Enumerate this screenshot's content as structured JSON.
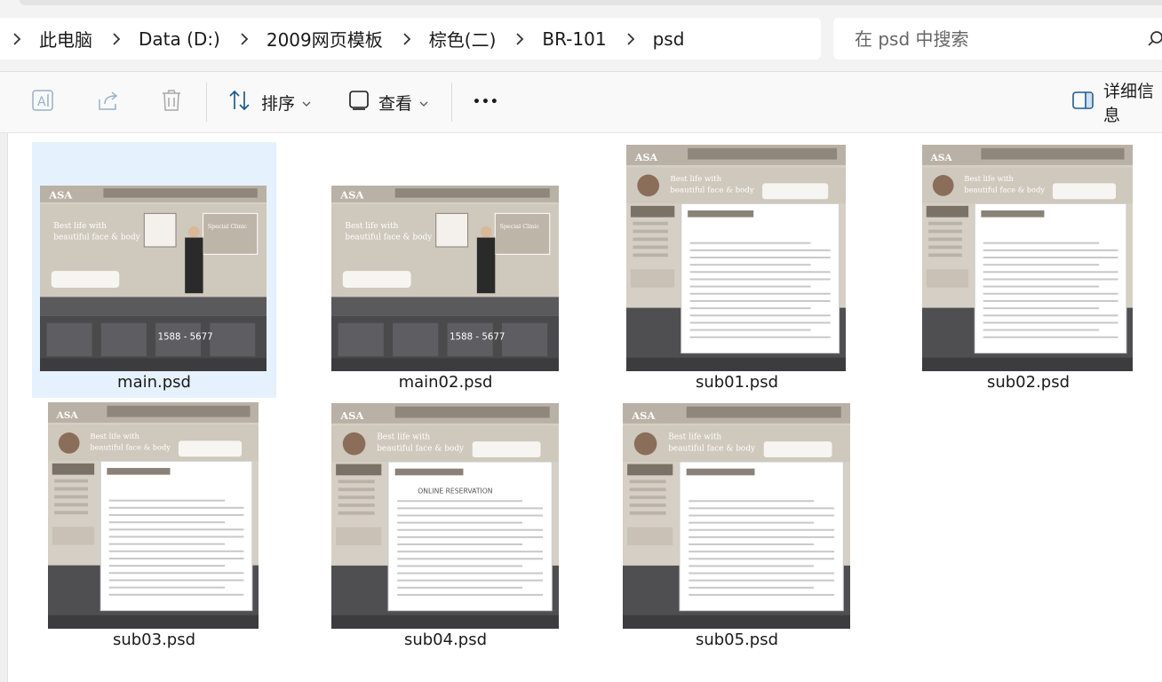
{
  "address": {
    "breadcrumbs": [
      "此电脑",
      "Data (D:)",
      "2009网页模板",
      "棕色(二)",
      "BR-101",
      "psd"
    ],
    "search_placeholder": "在 psd 中搜索"
  },
  "toolbar": {
    "sort_label": "排序",
    "view_label": "查看",
    "more_label": "•••",
    "details_label": "详细信息"
  },
  "files": [
    {
      "name": "main.psd",
      "selected": true,
      "style": "main"
    },
    {
      "name": "main02.psd",
      "selected": false,
      "style": "main"
    },
    {
      "name": "sub01.psd",
      "selected": false,
      "style": "sub"
    },
    {
      "name": "sub02.psd",
      "selected": false,
      "style": "sub"
    },
    {
      "name": "sub03.psd",
      "selected": false,
      "style": "sub"
    },
    {
      "name": "sub04.psd",
      "selected": false,
      "style": "sub"
    },
    {
      "name": "sub05.psd",
      "selected": false,
      "style": "sub"
    }
  ],
  "thumbnail_text": {
    "logo": "ASA",
    "tagline1": "Best life with",
    "tagline2": "beautiful face & body",
    "phone": "1588 - 5677",
    "clinic": "Special Clinic",
    "online": "ONLINE RESERVATION"
  },
  "colors": {
    "selection": "#e5f2fd",
    "window_bg": "#f3f3f3",
    "thumb_header": "#4a4a4d",
    "thumb_sand": "#cfc8bd"
  }
}
